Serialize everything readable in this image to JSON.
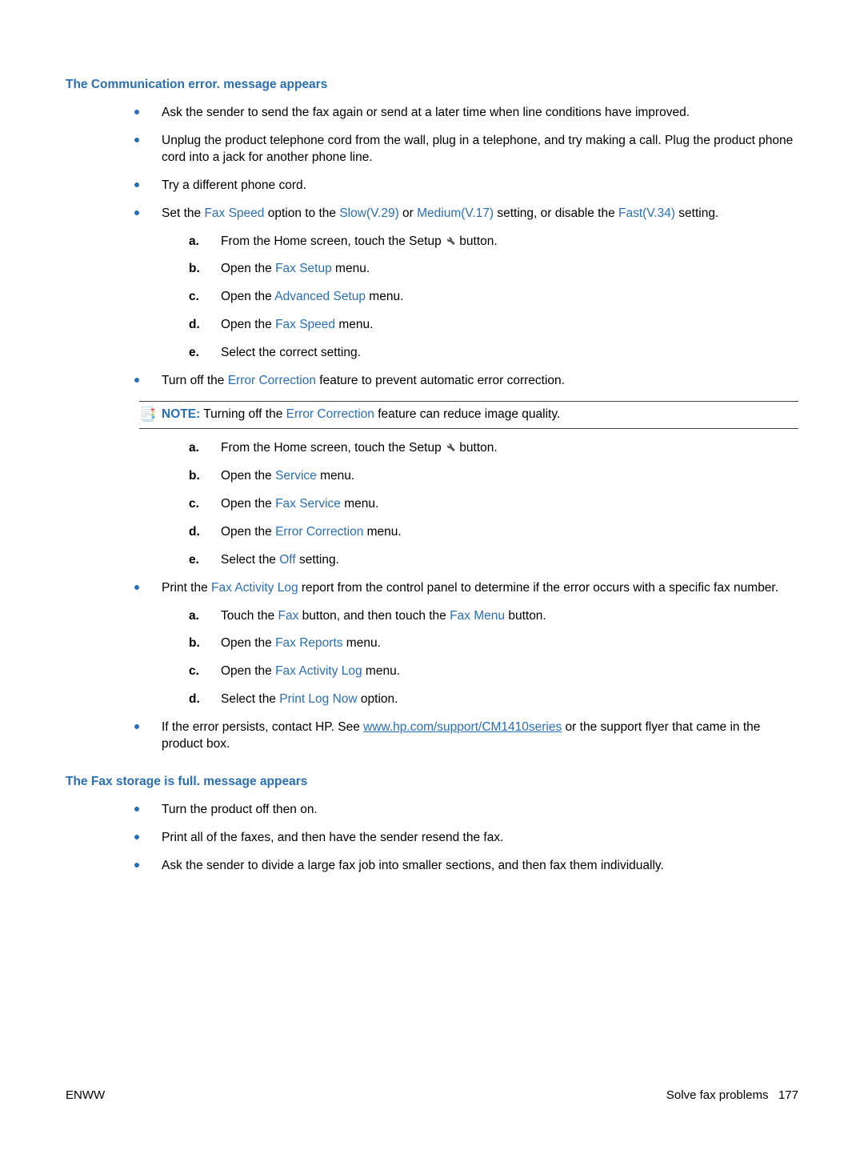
{
  "section1": {
    "heading": "The Communication error. message appears",
    "bullets": {
      "b1": "Ask the sender to send the fax again or send at a later time when line conditions have improved.",
      "b2": "Unplug the product telephone cord from the wall, plug in a telephone, and try making a call. Plug the product phone cord into a jack for another phone line.",
      "b3": "Try a different phone cord.",
      "b4": {
        "pre": "Set the ",
        "kw1": "Fax Speed",
        "mid1": " option to the ",
        "kw2": "Slow(V.29)",
        "mid2": " or ",
        "kw3": "Medium(V.17)",
        "mid3": " setting, or disable the ",
        "kw4": "Fast(V.34)",
        "post": " setting.",
        "steps": {
          "a": {
            "m": "a.",
            "pre": "From the Home screen, touch the Setup ",
            "post": " button."
          },
          "b": {
            "m": "b.",
            "pre": "Open the ",
            "kw": "Fax Setup",
            "post": " menu."
          },
          "c": {
            "m": "c.",
            "pre": "Open the ",
            "kw": "Advanced Setup",
            "post": " menu."
          },
          "d": {
            "m": "d.",
            "pre": "Open the ",
            "kw": "Fax Speed",
            "post": " menu."
          },
          "e": {
            "m": "e.",
            "t": "Select the correct setting."
          }
        }
      },
      "b5": {
        "pre": "Turn off the ",
        "kw": "Error Correction",
        "post": " feature to prevent automatic error correction.",
        "note": {
          "label": "NOTE:",
          "pre": "   Turning off the ",
          "kw": "Error Correction",
          "post": " feature can reduce image quality."
        },
        "steps": {
          "a": {
            "m": "a.",
            "pre": "From the Home screen, touch the Setup ",
            "post": " button."
          },
          "b": {
            "m": "b.",
            "pre": "Open the ",
            "kw": "Service",
            "post": " menu."
          },
          "c": {
            "m": "c.",
            "pre": "Open the ",
            "kw": "Fax Service",
            "post": " menu."
          },
          "d": {
            "m": "d.",
            "pre": "Open the ",
            "kw": "Error Correction",
            "post": " menu."
          },
          "e": {
            "m": "e.",
            "pre": "Select the ",
            "kw": "Off",
            "post": " setting."
          }
        }
      },
      "b6": {
        "pre": "Print the ",
        "kw": "Fax Activity Log",
        "post": " report from the control panel to determine if the error occurs with a specific fax number.",
        "steps": {
          "a": {
            "m": "a.",
            "pre": "Touch the ",
            "kw1": "Fax",
            "mid": " button, and then touch the ",
            "kw2": "Fax Menu",
            "post": " button."
          },
          "b": {
            "m": "b.",
            "pre": "Open the ",
            "kw": "Fax Reports",
            "post": " menu."
          },
          "c": {
            "m": "c.",
            "pre": "Open the ",
            "kw": "Fax Activity Log",
            "post": " menu."
          },
          "d": {
            "m": "d.",
            "pre": "Select the ",
            "kw": "Print Log Now",
            "post": " option."
          }
        }
      },
      "b7": {
        "pre": "If the error persists, contact HP. See ",
        "link": "www.hp.com/support/CM1410series",
        "post": " or the support flyer that came in the product box."
      }
    }
  },
  "section2": {
    "heading": "The Fax storage is full. message appears",
    "bullets": {
      "b1": "Turn the product off then on.",
      "b2": "Print all of the faxes, and then have the sender resend the fax.",
      "b3": "Ask the sender to divide a large fax job into smaller sections, and then fax them individually."
    }
  },
  "footer": {
    "left": "ENWW",
    "rightLabel": "Solve fax problems",
    "pageNum": "177"
  }
}
